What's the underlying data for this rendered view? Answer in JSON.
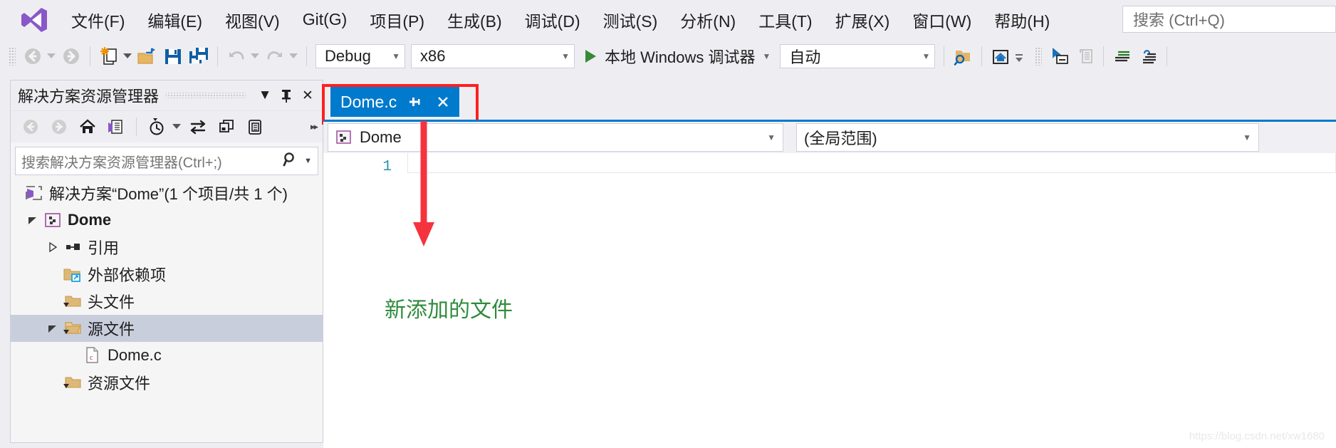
{
  "menu": {
    "items": [
      {
        "label": "文件(F)"
      },
      {
        "label": "编辑(E)"
      },
      {
        "label": "视图(V)"
      },
      {
        "label": "Git(G)"
      },
      {
        "label": "项目(P)"
      },
      {
        "label": "生成(B)"
      },
      {
        "label": "调试(D)"
      },
      {
        "label": "测试(S)"
      },
      {
        "label": "分析(N)"
      },
      {
        "label": "工具(T)"
      },
      {
        "label": "扩展(X)"
      },
      {
        "label": "窗口(W)"
      },
      {
        "label": "帮助(H)"
      }
    ],
    "quick_search_placeholder": "搜索 (Ctrl+Q)"
  },
  "toolbar": {
    "icons": [
      {
        "name": "navigate-back-icon"
      },
      {
        "name": "navigate-forward-icon"
      },
      {
        "name": "new-project-icon"
      },
      {
        "name": "open-file-icon"
      },
      {
        "name": "save-icon"
      },
      {
        "name": "save-all-icon"
      },
      {
        "name": "undo-icon"
      },
      {
        "name": "redo-icon"
      }
    ],
    "configuration": "Debug",
    "platform": "x86",
    "run_label": "本地 Windows 调试器",
    "attach_target": "自动",
    "right_icons": [
      {
        "name": "find-in-files-icon"
      },
      {
        "name": "home-icon"
      },
      {
        "name": "select-tool-icon"
      },
      {
        "name": "copy-lines-icon"
      },
      {
        "name": "comment-lines-icon"
      },
      {
        "name": "uncomment-lines-icon"
      }
    ]
  },
  "solution_explorer": {
    "title": "解决方案资源管理器",
    "header_buttons": [
      {
        "name": "dropdown-menu-icon",
        "glyph": "▼"
      },
      {
        "name": "pin-icon",
        "glyph": "⚲"
      },
      {
        "name": "close-icon",
        "glyph": "✕"
      }
    ],
    "tool_buttons": [
      {
        "name": "back-icon"
      },
      {
        "name": "forward-icon"
      },
      {
        "name": "home-icon"
      },
      {
        "name": "solution-view-icon"
      },
      {
        "name": "pending-changes-icon"
      },
      {
        "name": "sync-with-active-document-icon"
      },
      {
        "name": "refresh-icon"
      },
      {
        "name": "show-all-files-icon"
      },
      {
        "name": "overflow-icon"
      }
    ],
    "search_placeholder": "搜索解决方案资源管理器(Ctrl+;)",
    "search_icon": "search-icon",
    "tree": [
      {
        "label": "解决方案“Dome”(1 个项目/共 1 个)",
        "indent": 0,
        "icon": "solution-icon",
        "expander": "",
        "bold": false,
        "selected": false
      },
      {
        "label": "Dome",
        "indent": 1,
        "icon": "project-icon",
        "expander": "▼",
        "bold": true,
        "selected": false
      },
      {
        "label": "引用",
        "indent": 2,
        "icon": "references-icon",
        "expander": "▶",
        "bold": false,
        "selected": false
      },
      {
        "label": "外部依赖项",
        "indent": 2,
        "icon": "external-dependencies-icon",
        "expander": "",
        "bold": false,
        "selected": false
      },
      {
        "label": "头文件",
        "indent": 2,
        "icon": "header-folder-icon",
        "expander": "",
        "bold": false,
        "selected": false
      },
      {
        "label": "源文件",
        "indent": 2,
        "icon": "source-folder-icon",
        "expander": "▼",
        "bold": false,
        "selected": true
      },
      {
        "label": "Dome.c",
        "indent": 3,
        "icon": "c-file-icon",
        "expander": "",
        "bold": false,
        "selected": false
      },
      {
        "label": "资源文件",
        "indent": 2,
        "icon": "resource-folder-icon",
        "expander": "",
        "bold": false,
        "selected": false
      }
    ]
  },
  "editor": {
    "tab": {
      "title": "Dome.c",
      "pin_icon": "pin-icon",
      "close_icon": "close-icon"
    },
    "navigation_bar": {
      "project": "Dome",
      "scope": "(全局范围)",
      "project_icon": "project-icon"
    },
    "line_numbers": [
      "1"
    ],
    "code_lines": [
      ""
    ]
  },
  "annotations": {
    "arrow_color": "#F5333F",
    "note_text": "新添加的文件",
    "note_color": "#2E8B3C",
    "tab_highlight_color": "#FF2020"
  },
  "watermark": "https://blog.csdn.net/xw1680"
}
